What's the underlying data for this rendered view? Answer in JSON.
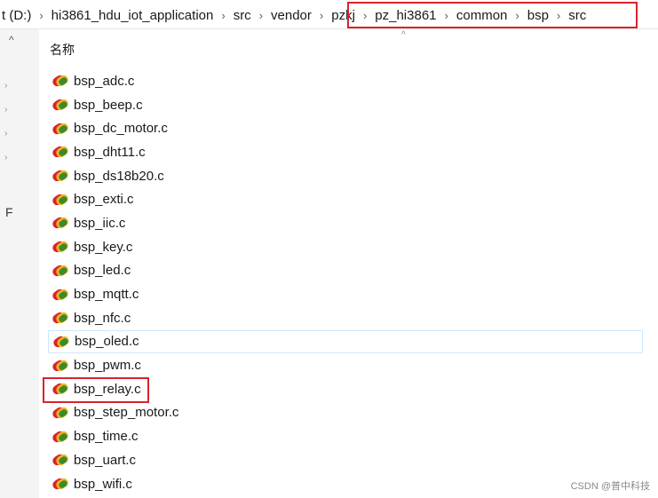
{
  "breadcrumb": {
    "drive_fragment": "t (D:)",
    "items": [
      "hi3861_hdu_iot_application",
      "src",
      "vendor",
      "pzkj",
      "pz_hi3861",
      "common",
      "bsp",
      "src"
    ]
  },
  "column_header": "名称",
  "files": [
    "bsp_adc.c",
    "bsp_beep.c",
    "bsp_dc_motor.c",
    "bsp_dht11.c",
    "bsp_ds18b20.c",
    "bsp_exti.c",
    "bsp_iic.c",
    "bsp_key.c",
    "bsp_led.c",
    "bsp_mqtt.c",
    "bsp_nfc.c",
    "bsp_oled.c",
    "bsp_pwm.c",
    "bsp_relay.c",
    "bsp_step_motor.c",
    "bsp_time.c",
    "bsp_uart.c",
    "bsp_wifi.c"
  ],
  "selected_file_index": 11,
  "highlighted_file_index": 13,
  "nav_fragment": "F",
  "file_icon": "c-source-file-icon",
  "highlight_color": "#d9232d",
  "selection_color": "#cce8ff",
  "watermark": "CSDN @普中科技"
}
